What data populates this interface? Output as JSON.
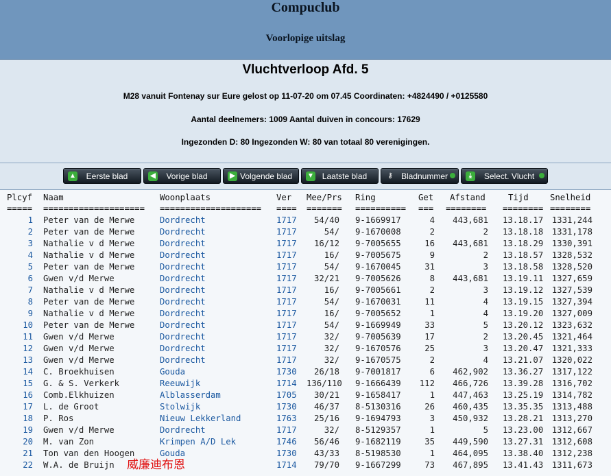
{
  "header": {
    "title": "Compuclub",
    "subtitle": "Voorlopige uitslag"
  },
  "race": {
    "title": "Vluchtverloop Afd. 5",
    "line1": "M28 vanuit Fontenay sur Eure gelost op 11-07-20 om 07.45 Coordinaten: +4824490 / +0125580",
    "line2": "Aantal deelnemers: 1009 Aantal duiven in concours: 17629",
    "line3": "Ingezonden D: 80 Ingezonden W: 80 van totaal 80 verenigingen."
  },
  "toolbar": {
    "first": "Eerste blad",
    "prev": "Vorige blad",
    "next": "Volgende blad",
    "last": "Laatste blad",
    "page": "Bladnummer",
    "select": "Select. Vlucht"
  },
  "icons": {
    "first": "arrow-up-icon",
    "prev": "arrow-left-icon",
    "next": "arrow-right-icon",
    "last": "arrow-down-icon",
    "page": "key-icon",
    "select": "download-icon"
  },
  "colors": {
    "header": "#7096bd",
    "panel": "#dde7f0",
    "link": "#1a58a0",
    "button": "#1c252e",
    "icon_green": "#3cae3c"
  },
  "table": {
    "headers": {
      "place": "Plcyf",
      "name": "Naam",
      "town": "Woonplaats",
      "ver": "Ver",
      "mee": "Mee/Prs",
      "ring": "Ring",
      "get": "Get",
      "afstand": "Afstand",
      "tijd": "Tijd",
      "snelheid": "Snelheid"
    },
    "underlines": {
      "place": "=====",
      "name": "====================",
      "town": "====================",
      "ver": "====",
      "mee": "=======",
      "ring": "==========",
      "get": "===",
      "afstand": "========",
      "tijd": "========",
      "snelheid": "========"
    },
    "rows": [
      {
        "place": "1",
        "name": "Peter van de Merwe",
        "town": "Dordrecht",
        "ver": "1717",
        "mee": "54/40",
        "ring": "9-1669917",
        "get": "4",
        "afstand": "443,681",
        "tijd": "13.18.17",
        "snelheid": "1331,244"
      },
      {
        "place": "2",
        "name": "Peter van de Merwe",
        "town": "Dordrecht",
        "ver": "1717",
        "mee": "54/",
        "ring": "9-1670008",
        "get": "2",
        "afstand": "2",
        "tijd": "13.18.18",
        "snelheid": "1331,178"
      },
      {
        "place": "3",
        "name": "Nathalie v d  Merwe",
        "town": "Dordrecht",
        "ver": "1717",
        "mee": "16/12",
        "ring": "9-7005655",
        "get": "16",
        "afstand": "443,681",
        "tijd": "13.18.29",
        "snelheid": "1330,391"
      },
      {
        "place": "4",
        "name": "Nathalie v d  Merwe",
        "town": "Dordrecht",
        "ver": "1717",
        "mee": "16/",
        "ring": "9-7005675",
        "get": "9",
        "afstand": "2",
        "tijd": "13.18.57",
        "snelheid": "1328,532"
      },
      {
        "place": "5",
        "name": "Peter van de Merwe",
        "town": "Dordrecht",
        "ver": "1717",
        "mee": "54/",
        "ring": "9-1670045",
        "get": "31",
        "afstand": "3",
        "tijd": "13.18.58",
        "snelheid": "1328,520"
      },
      {
        "place": "6",
        "name": "Gwen v/d Merwe",
        "town": "Dordrecht",
        "ver": "1717",
        "mee": "32/21",
        "ring": "9-7005626",
        "get": "8",
        "afstand": "443,681",
        "tijd": "13.19.11",
        "snelheid": "1327,659"
      },
      {
        "place": "7",
        "name": "Nathalie v d  Merwe",
        "town": "Dordrecht",
        "ver": "1717",
        "mee": "16/",
        "ring": "9-7005661",
        "get": "2",
        "afstand": "3",
        "tijd": "13.19.12",
        "snelheid": "1327,539"
      },
      {
        "place": "8",
        "name": "Peter van de Merwe",
        "town": "Dordrecht",
        "ver": "1717",
        "mee": "54/",
        "ring": "9-1670031",
        "get": "11",
        "afstand": "4",
        "tijd": "13.19.15",
        "snelheid": "1327,394"
      },
      {
        "place": "9",
        "name": "Nathalie v d  Merwe",
        "town": "Dordrecht",
        "ver": "1717",
        "mee": "16/",
        "ring": "9-7005652",
        "get": "1",
        "afstand": "4",
        "tijd": "13.19.20",
        "snelheid": "1327,009"
      },
      {
        "place": "10",
        "name": "Peter van de Merwe",
        "town": "Dordrecht",
        "ver": "1717",
        "mee": "54/",
        "ring": "9-1669949",
        "get": "33",
        "afstand": "5",
        "tijd": "13.20.12",
        "snelheid": "1323,632"
      },
      {
        "place": "11",
        "name": "Gwen v/d Merwe",
        "town": "Dordrecht",
        "ver": "1717",
        "mee": "32/",
        "ring": "9-7005639",
        "get": "17",
        "afstand": "2",
        "tijd": "13.20.45",
        "snelheid": "1321,464"
      },
      {
        "place": "12",
        "name": "Gwen v/d Merwe",
        "town": "Dordrecht",
        "ver": "1717",
        "mee": "32/",
        "ring": "9-1670576",
        "get": "25",
        "afstand": "3",
        "tijd": "13.20.47",
        "snelheid": "1321,333"
      },
      {
        "place": "13",
        "name": "Gwen v/d Merwe",
        "town": "Dordrecht",
        "ver": "1717",
        "mee": "32/",
        "ring": "9-1670575",
        "get": "2",
        "afstand": "4",
        "tijd": "13.21.07",
        "snelheid": "1320,022"
      },
      {
        "place": "14",
        "name": "C. Broekhuisen",
        "town": "Gouda",
        "ver": "1730",
        "mee": "26/18",
        "ring": "9-7001817",
        "get": "6",
        "afstand": "462,902",
        "tijd": "13.36.27",
        "snelheid": "1317,122"
      },
      {
        "place": "15",
        "name": "G. & S. Verkerk",
        "town": "Reeuwijk",
        "ver": "1714",
        "mee": "136/110",
        "ring": "9-1666439",
        "get": "112",
        "afstand": "466,726",
        "tijd": "13.39.28",
        "snelheid": "1316,702"
      },
      {
        "place": "16",
        "name": "Comb.Elkhuizen",
        "town": "Alblasserdam",
        "ver": "1705",
        "mee": "30/21",
        "ring": "9-1658417",
        "get": "1",
        "afstand": "447,463",
        "tijd": "13.25.19",
        "snelheid": "1314,782"
      },
      {
        "place": "17",
        "name": "L. de Groot",
        "town": "Stolwijk",
        "ver": "1730",
        "mee": "46/37",
        "ring": "8-5130316",
        "get": "26",
        "afstand": "460,435",
        "tijd": "13.35.35",
        "snelheid": "1313,488"
      },
      {
        "place": "18",
        "name": "P. Ros",
        "town": "Nieuw Lekkerland",
        "ver": "1763",
        "mee": "25/16",
        "ring": "9-1694793",
        "get": "3",
        "afstand": "450,932",
        "tijd": "13.28.21",
        "snelheid": "1313,270"
      },
      {
        "place": "19",
        "name": "Gwen v/d Merwe",
        "town": "Dordrecht",
        "ver": "1717",
        "mee": "32/",
        "ring": "8-5129357",
        "get": "1",
        "afstand": "5",
        "tijd": "13.23.00",
        "snelheid": "1312,667"
      },
      {
        "place": "20",
        "name": "M. van Zon",
        "town": "Krimpen A/D Lek",
        "ver": "1746",
        "mee": "56/46",
        "ring": "9-1682119",
        "get": "35",
        "afstand": "449,590",
        "tijd": "13.27.31",
        "snelheid": "1312,608"
      },
      {
        "place": "21",
        "name": "Ton van den Hoogen",
        "town": "Gouda",
        "ver": "1730",
        "mee": "43/33",
        "ring": "8-5198530",
        "get": "1",
        "afstand": "464,095",
        "tijd": "13.38.40",
        "snelheid": "1312,238"
      },
      {
        "place": "22",
        "name": "W.A. de Bruijn",
        "town": "",
        "ver": "1714",
        "mee": "79/70",
        "ring": "9-1667299",
        "get": "73",
        "afstand": "467,895",
        "tijd": "13.41.43",
        "snelheid": "1311,673"
      }
    ]
  },
  "watermark": "威廉迪布恩"
}
